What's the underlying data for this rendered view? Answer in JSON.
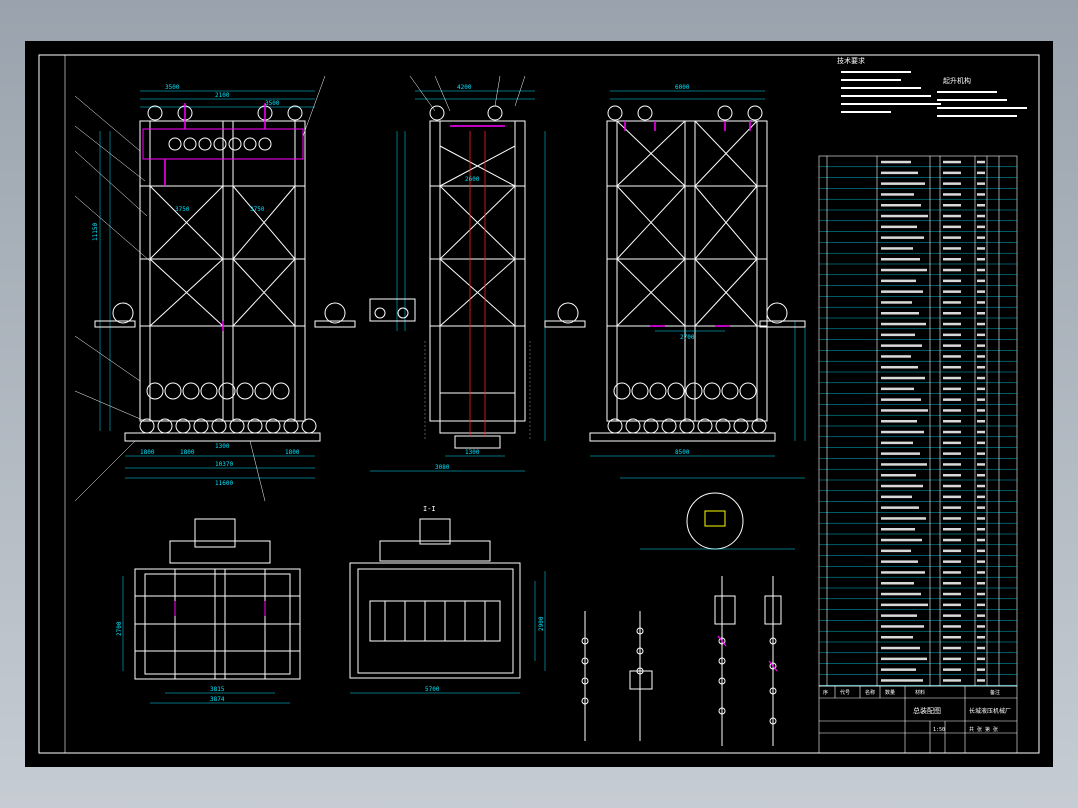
{
  "drawing": {
    "background": "#000000",
    "frame_color": "#ffffff",
    "structure_color": "#ffffff",
    "dimension_color": "#00e5ff",
    "highlight_color": "#ff00ff",
    "hidden_color": "#ff2020",
    "leader_color": "#ffff00"
  },
  "front_view": {
    "dims": {
      "top_a": "3500",
      "top_b": "2100",
      "top_c": "3500",
      "mid_a": "3750",
      "mid_b": "3750",
      "bot_a": "1800",
      "bot_b": "1800",
      "bot_c": "1800",
      "bot_center": "1300",
      "overall": "10370",
      "overall_2": "11600",
      "height_left": "11150"
    },
    "callouts": [
      "11",
      "15",
      "16",
      "17",
      "18",
      "19",
      "[20]",
      "[21]",
      "22"
    ]
  },
  "side_view": {
    "dims": {
      "top": "4200",
      "width": "2600",
      "bottom": "3080",
      "base": "1300"
    },
    "callouts": [
      "23",
      "24",
      "25",
      "26",
      "27"
    ]
  },
  "rear_view": {
    "dims": {
      "top": "6000",
      "mid": "2700",
      "bottom": "8500"
    },
    "callouts": [
      "[24]",
      "[25]",
      "[26]",
      "[27]",
      "28",
      "29"
    ]
  },
  "plan_left": {
    "dims": {
      "width": "3874",
      "inner": "3815",
      "depth": "2700"
    }
  },
  "plan_right": {
    "dims": {
      "width": "5700",
      "inner": "4500",
      "depth": "2900"
    },
    "label": "I-I"
  },
  "notes": {
    "title": "技术要求",
    "right_title": "起升机构"
  },
  "title_block": {
    "drawing_name": "总装配图",
    "company": "长城液压机械厂",
    "scale": "1:50",
    "sheet": "共 张 第 张",
    "head_cols": [
      "序",
      "代号",
      "名称",
      "数量",
      "材料",
      "单重",
      "总重",
      "备注"
    ]
  }
}
